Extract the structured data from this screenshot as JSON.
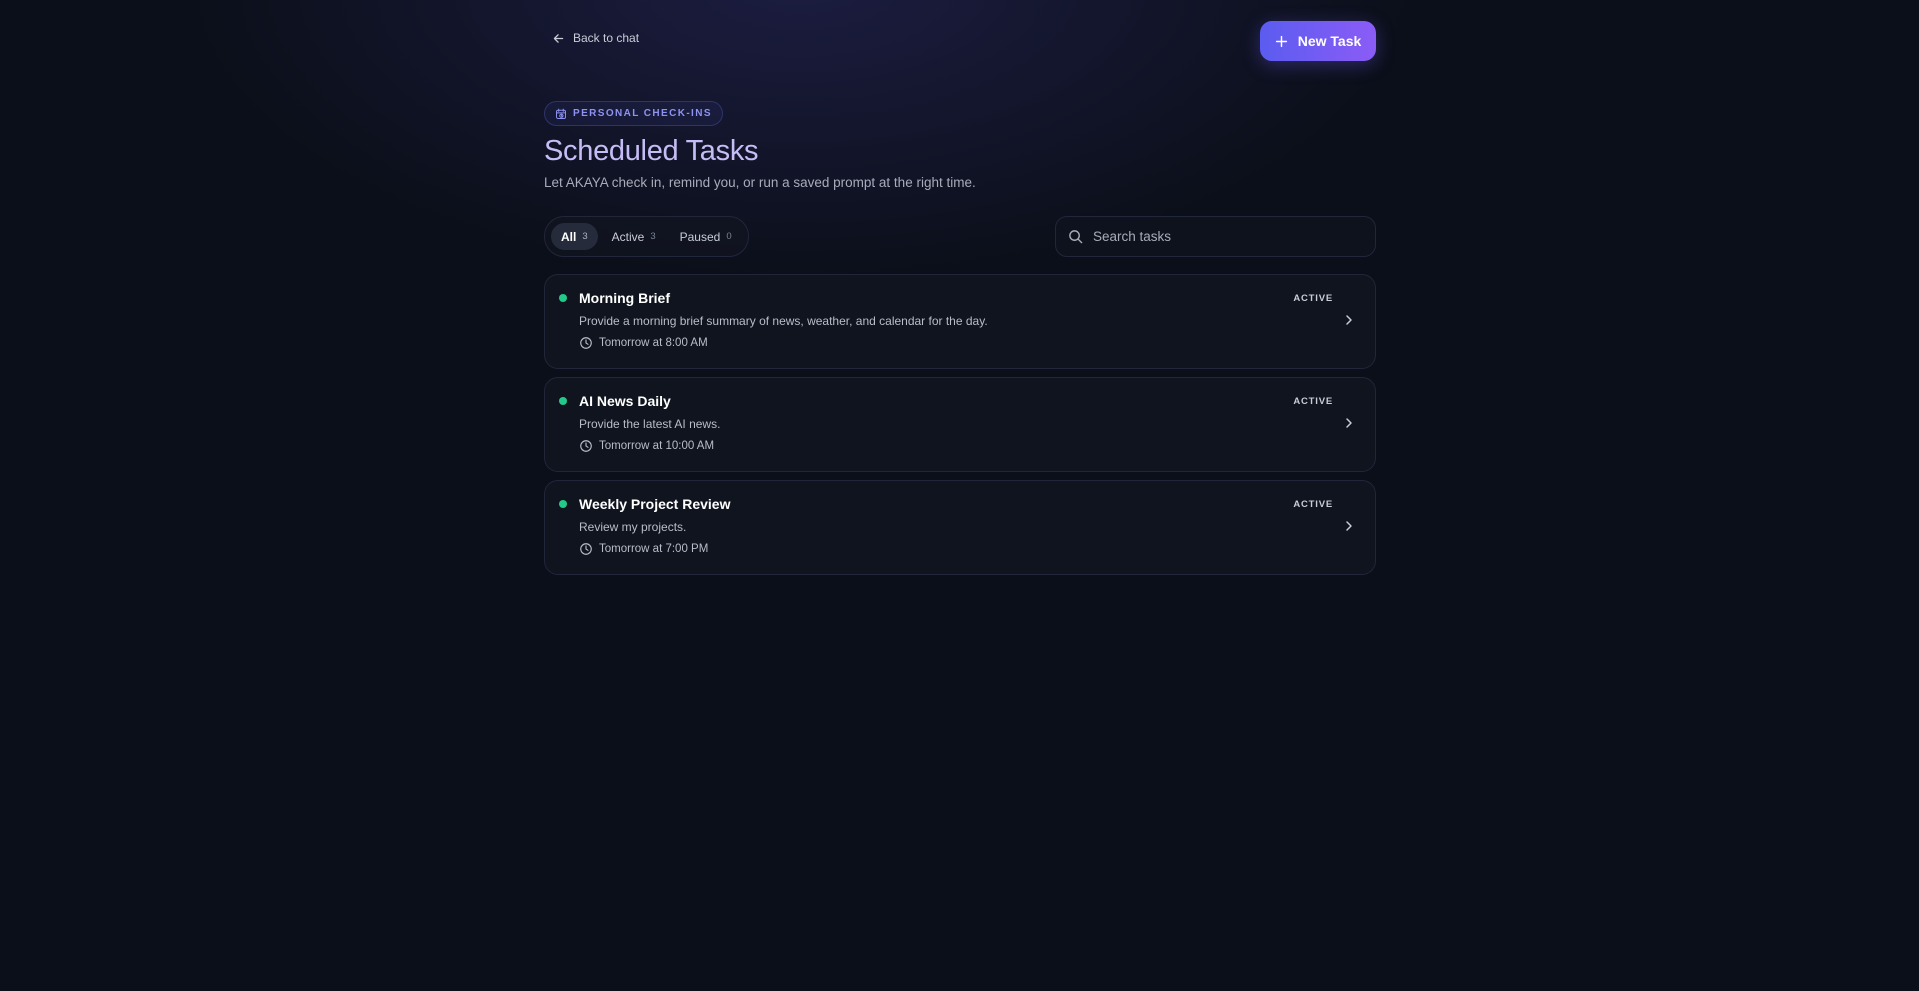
{
  "nav": {
    "back_label": "Back to chat",
    "new_task_label": "New Task"
  },
  "header": {
    "badge": "PERSONAL CHECK-INS",
    "title": "Scheduled Tasks",
    "subtitle": "Let AKAYA check in, remind you, or run a saved prompt at the right time."
  },
  "filters": [
    {
      "label": "All",
      "count": "3",
      "selected": true
    },
    {
      "label": "Active",
      "count": "3",
      "selected": false
    },
    {
      "label": "Paused",
      "count": "0",
      "selected": false
    }
  ],
  "search": {
    "placeholder": "Search tasks",
    "value": ""
  },
  "tasks": [
    {
      "title": "Morning Brief",
      "description": "Provide a morning brief summary of news, weather, and calendar for the day.",
      "schedule": "Tomorrow at 8:00 AM",
      "status": "ACTIVE"
    },
    {
      "title": "AI News Daily",
      "description": "Provide the latest AI news.",
      "schedule": "Tomorrow at 10:00 AM",
      "status": "ACTIVE"
    },
    {
      "title": "Weekly Project Review",
      "description": "Review my projects.",
      "schedule": "Tomorrow at 7:00 PM",
      "status": "ACTIVE"
    }
  ],
  "colors": {
    "accent_start": "#5b5cf0",
    "accent_end": "#8b5cf6",
    "status_active": "#22c98a",
    "title": "#c5bdf5",
    "background": "#0b0f19"
  },
  "icons": {
    "back": "arrow-left-icon",
    "new_task": "plus-icon",
    "badge": "calendar-clock-icon",
    "search": "search-icon",
    "schedule": "clock-icon",
    "open_task": "chevron-right-icon"
  }
}
